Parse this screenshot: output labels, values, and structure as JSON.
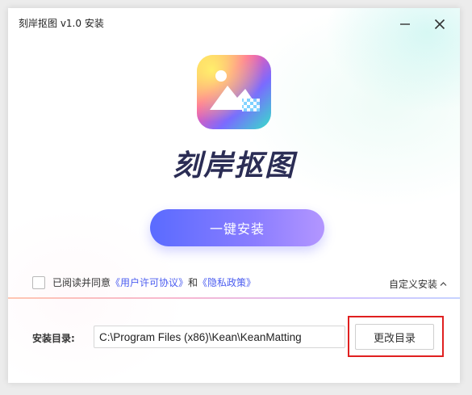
{
  "window": {
    "title": "刻岸抠图  v1.0 安装"
  },
  "icons": {
    "minimize": "minimize-icon",
    "close": "close-icon",
    "logo": "app-logo-icon",
    "chevron": "chevron-up-icon"
  },
  "brand": {
    "name": "刻岸抠图"
  },
  "install": {
    "button_label": "一键安装"
  },
  "agreement": {
    "prefix": "已阅读并同意",
    "user_agreement": "《用户许可协议》",
    "and": "和",
    "privacy_policy": "《隐私政策》",
    "checked": false
  },
  "custom_install": {
    "label": "自定义安装"
  },
  "directory": {
    "label": "安装目录:",
    "value": "C:\\Program Files (x86)\\Kean\\KeanMatting",
    "change_button": "更改目录"
  },
  "colors": {
    "accent_start": "#5a6bff",
    "accent_end": "#b396ff",
    "link": "#4a5cf0",
    "highlight": "#e02020"
  }
}
